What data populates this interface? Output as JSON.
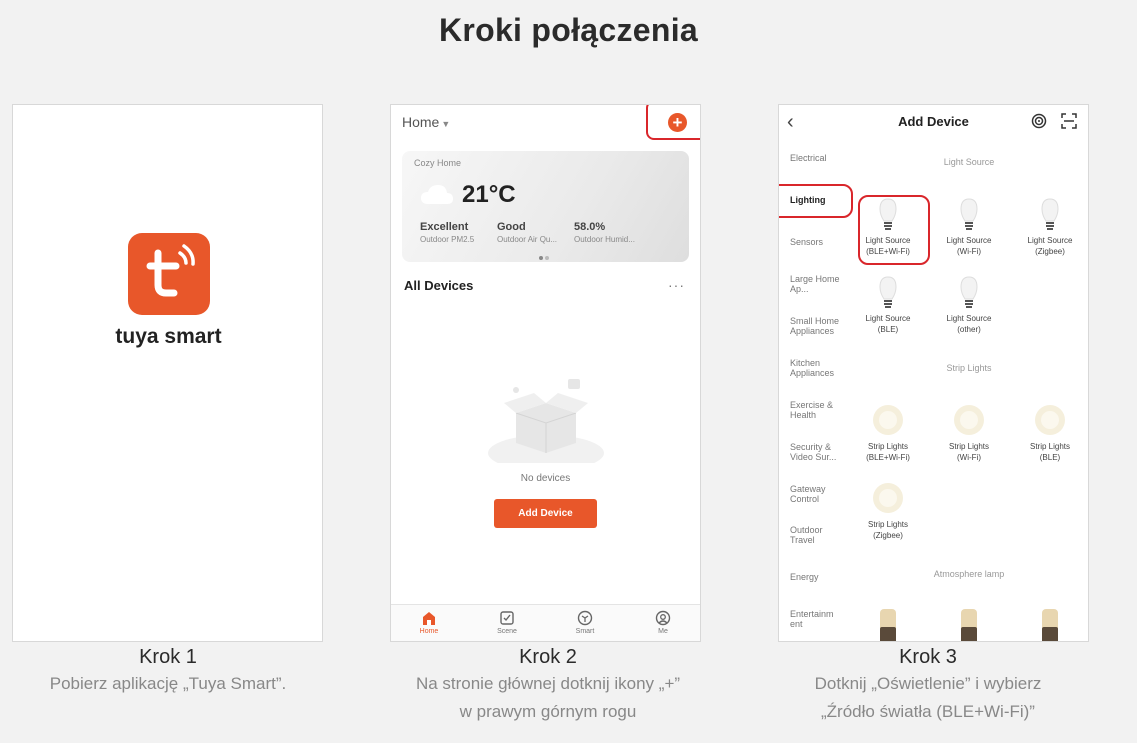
{
  "title": "Kroki połączenia",
  "steps": [
    {
      "title": "Krok 1",
      "desc1": "Pobierz aplikację „Tuya Smart”.",
      "desc2": ""
    },
    {
      "title": "Krok 2",
      "desc1": "Na stronie głównej dotknij ikony „+”",
      "desc2": "w prawym górnym rogu"
    },
    {
      "title": "Krok 3",
      "desc1": "Dotknij „Oświetlenie” i wybierz",
      "desc2": "„Źródło światła (BLE+Wi-Fi)”"
    }
  ],
  "panel1": {
    "app_name": "tuya smart",
    "brand_color": "#e8572a"
  },
  "panel2": {
    "home_label": "Home",
    "plus": "+",
    "card": {
      "title": "Cozy Home",
      "temp": "21°C",
      "stats": [
        {
          "value": "Excellent",
          "label": "Outdoor PM2.5"
        },
        {
          "value": "Good",
          "label": "Outdoor Air Qu..."
        },
        {
          "value": "58.0%",
          "label": "Outdoor Humid..."
        }
      ]
    },
    "all_devices": "All Devices",
    "more": "···",
    "empty_text": "No devices",
    "add_device": "Add Device",
    "tabs": [
      "Home",
      "Scene",
      "Smart",
      "Me"
    ],
    "active_color": "#e8572a",
    "highlight_color": "#d9262b"
  },
  "panel3": {
    "back": "‹",
    "title": "Add Device",
    "categories": [
      "Electrical",
      "Lighting",
      "Sensors",
      "Large Home Ap...",
      "Small Home Appliances",
      "Kitchen Appliances",
      "Exercise & Health",
      "Security & Video Sur...",
      "Gateway Control",
      "Outdoor Travel",
      "Energy",
      "Entertainm ent"
    ],
    "selected_category": "Lighting",
    "sections": [
      "Light Source",
      "Strip Lights",
      "Atmosphere lamp"
    ],
    "light_sources": [
      {
        "line1": "Light Source",
        "line2": "(BLE+Wi-Fi)"
      },
      {
        "line1": "Light Source",
        "line2": "(Wi-Fi)"
      },
      {
        "line1": "Light Source",
        "line2": "(Zigbee)"
      },
      {
        "line1": "Light Source",
        "line2": "(BLE)"
      },
      {
        "line1": "Light Source",
        "line2": "(other)"
      }
    ],
    "strip_lights": [
      {
        "line1": "Strip Lights",
        "line2": "(BLE+Wi-Fi)"
      },
      {
        "line1": "Strip Lights",
        "line2": "(Wi-Fi)"
      },
      {
        "line1": "Strip Lights",
        "line2": "(BLE)"
      },
      {
        "line1": "Strip Lights",
        "line2": "(Zigbee)"
      }
    ]
  }
}
